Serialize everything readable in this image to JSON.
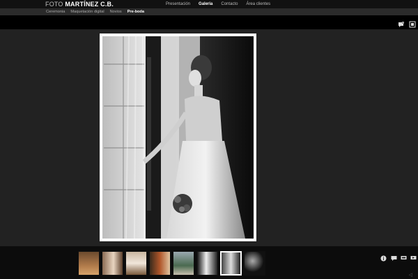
{
  "brand": {
    "light": "FOTO ",
    "bold": "MARTÍNEZ C.B."
  },
  "nav": [
    {
      "label": "Presentación",
      "active": false
    },
    {
      "label": "Galeria",
      "active": true
    },
    {
      "label": "Contacto",
      "active": false
    },
    {
      "label": "Área clientes",
      "active": false
    }
  ],
  "subnav": [
    {
      "label": "Ceremonia",
      "active": false
    },
    {
      "label": "Maquetación digital",
      "active": false
    },
    {
      "label": "Novios",
      "active": false
    },
    {
      "label": "Pre-boda",
      "active": true
    }
  ],
  "top_controls": [
    "comment-icon",
    "fullscreen-icon"
  ],
  "bottom_controls": [
    "info-icon",
    "comment-icon",
    "share-icon",
    "slideshow-icon"
  ],
  "thumbnails": [
    {
      "name": "thumbnail-1",
      "palette": "warm",
      "active": false
    },
    {
      "name": "thumbnail-2",
      "palette": "warm",
      "active": false
    },
    {
      "name": "thumbnail-3",
      "palette": "warm",
      "active": false
    },
    {
      "name": "thumbnail-4",
      "palette": "warm",
      "active": false
    },
    {
      "name": "thumbnail-5",
      "palette": "cool",
      "active": false
    },
    {
      "name": "thumbnail-6",
      "palette": "bw",
      "active": false
    },
    {
      "name": "thumbnail-7",
      "palette": "bw",
      "active": true
    },
    {
      "name": "thumbnail-8",
      "palette": "bw",
      "active": false
    }
  ],
  "colors": {
    "background": "#222222",
    "bar": "#111111",
    "subbar": "#2b2b2b",
    "frame": "#ffffff"
  }
}
